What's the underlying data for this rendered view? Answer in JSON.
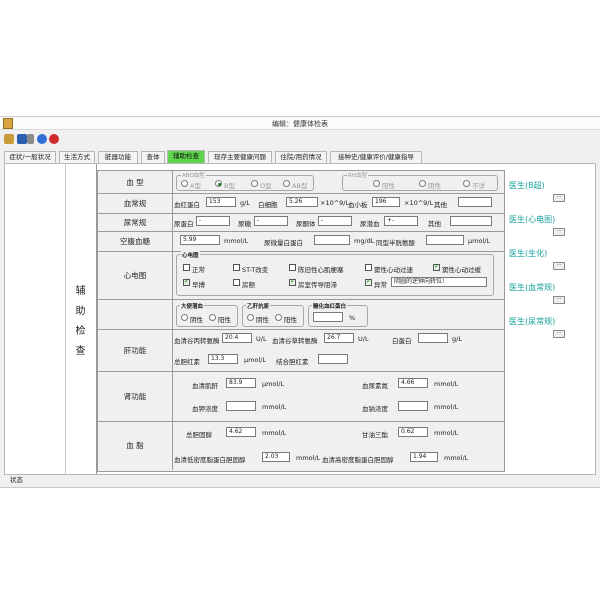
{
  "window": {
    "title": "编辑：健康体检表"
  },
  "toolbar": {
    "icons": [
      "edit-icon",
      "save-icon",
      "print-icon",
      "help-icon",
      "close-icon"
    ]
  },
  "tabs": [
    {
      "label": "症状/一般状况"
    },
    {
      "label": "生活方式"
    },
    {
      "label": "脏器功能"
    },
    {
      "label": "查体"
    },
    {
      "label": "辅助检查"
    },
    {
      "label": "现存主要健康问题"
    },
    {
      "label": "住院/用药情况"
    },
    {
      "label": "接种史/健康评价/健康指导"
    }
  ],
  "side_label": "辅助检查",
  "blood_type": {
    "label": "血 型",
    "abo_title": "ABO血型",
    "abo": [
      "A型",
      "B型",
      "O型",
      "AB型"
    ],
    "rh_title": "RH血型",
    "rh": [
      "阳性",
      "阴性",
      "不详"
    ]
  },
  "blood_routine": {
    "label": "血常规",
    "hb_label": "血红蛋白",
    "hb_value": "153",
    "hb_unit": "g/L",
    "wbc_label": "白细胞",
    "wbc_value": "5.26",
    "wbc_unit": "×10^9/L",
    "plt_label": "血小板",
    "plt_value": "196",
    "plt_unit": "×10^9/L",
    "other_label": "其他"
  },
  "urine_routine": {
    "label": "尿常规",
    "pro_label": "尿蛋白",
    "pro_value": "-",
    "glu_label": "尿糖",
    "glu_value": "-",
    "ket_label": "尿酮体",
    "ket_value": "-",
    "bld_label": "尿潜血",
    "bld_value": "+-",
    "other_label": "其他"
  },
  "fasting_glucose": {
    "label": "空腹血糖",
    "value": "5.99",
    "unit": "mmol/L",
    "malb_label": "尿微量白蛋白",
    "malb_unit": "mg/dL",
    "hcy_label": "同型半胱氨酸",
    "hcy_unit": "μmol/L"
  },
  "ecg": {
    "label": "心电图",
    "title": "心电图",
    "items": [
      {
        "label": "正常",
        "checked": false
      },
      {
        "label": "ST-T改变",
        "checked": false
      },
      {
        "label": "陈旧性心肌梗塞",
        "checked": false
      },
      {
        "label": "窦性心动过速",
        "checked": false
      },
      {
        "label": "窦性心动过缓",
        "checked": true
      },
      {
        "label": "早搏",
        "checked": true
      },
      {
        "label": "房颤",
        "checked": false
      },
      {
        "label": "房室传导阻滞",
        "checked": true
      },
      {
        "label": "异常",
        "checked": true
      }
    ],
    "abnormal_text": "阴圆的逆钟向转位!"
  },
  "stool_hbv": {
    "occult_title": "大便潜血",
    "occult_opts": [
      "阴性",
      "阳性"
    ],
    "hbsag_title": "乙肝抗原",
    "hbsag_opts": [
      "阴性",
      "阳性"
    ],
    "hba1c_title": "糖化血红蛋白",
    "hba1c_unit": "%"
  },
  "liver": {
    "label": "肝功能",
    "alt_label": "血清谷丙转氨酶",
    "alt_value": "20.4",
    "alt_unit": "U/L",
    "ast_label": "血清谷草转氨酶",
    "ast_value": "26.7",
    "ast_unit": "U/L",
    "alb_label": "白蛋白",
    "alb_unit": "g/L",
    "tbil_label": "总胆红素",
    "tbil_value": "13.3",
    "tbil_unit": "μmol/L",
    "dbil_label": "结合胆红素"
  },
  "kidney": {
    "label": "肾功能",
    "scr_label": "血清肌酐",
    "scr_value": "83.9",
    "scr_unit": "μmol/L",
    "bun_label": "血尿素氮",
    "bun_value": "4.66",
    "bun_unit": "mmol/L",
    "k_label": "血钾浓度",
    "k_unit": "mmol/L",
    "na_label": "血钠浓度",
    "na_unit": "mmol/L"
  },
  "lipid": {
    "label": "血 脂",
    "tc_label": "总胆固醇",
    "tc_value": "4.62",
    "tc_unit": "mmol/L",
    "tg_label": "甘油三酯",
    "tg_value": "0.62",
    "tg_unit": "mmol/L",
    "ldl_label": "血清低密度脂蛋白胆固醇",
    "ldl_value": "2.03",
    "ldl_unit": "mmol/L",
    "hdl_label": "血清高密度脂蛋白胆固醇",
    "hdl_value": "1.94",
    "hdl_unit": "mmol/L"
  },
  "doctors": [
    {
      "label": "医生(B超)"
    },
    {
      "label": "医生(心电图)"
    },
    {
      "label": "医生(生化)"
    },
    {
      "label": "医生(血常规)"
    },
    {
      "label": "医生(尿常规)"
    }
  ],
  "status": {
    "label": "状态"
  }
}
